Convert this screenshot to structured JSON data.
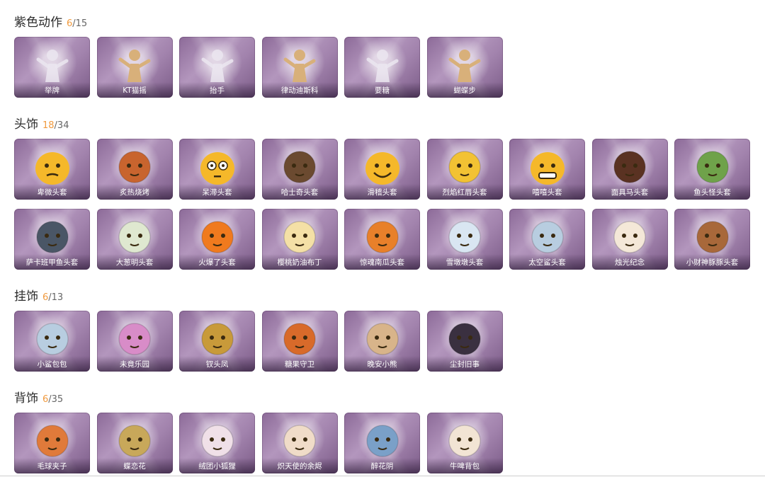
{
  "sections": [
    {
      "title": "紫色动作",
      "owned": "6",
      "total": "/15",
      "items": [
        {
          "label": "举牌",
          "icon": "sign-pose-icon"
        },
        {
          "label": "KT猫摇",
          "icon": "cat-shake-pose-icon"
        },
        {
          "label": "抬手",
          "icon": "raise-hand-pose-icon"
        },
        {
          "label": "律动迪斯科",
          "icon": "disco-pose-icon"
        },
        {
          "label": "要糖",
          "icon": "ask-candy-pose-icon"
        },
        {
          "label": "蝴蝶步",
          "icon": "butterfly-step-pose-icon"
        }
      ]
    },
    {
      "title": "头饰",
      "owned": "18",
      "total": "/34",
      "items": [
        {
          "label": "卑微头套",
          "icon": "humble-emoji-head-icon"
        },
        {
          "label": "炙热烧烤",
          "icon": "grill-head-icon"
        },
        {
          "label": "呆滞头套",
          "icon": "dazed-emoji-head-icon"
        },
        {
          "label": "哈士奇头套",
          "icon": "husky-head-icon"
        },
        {
          "label": "滑稽头套",
          "icon": "funny-emoji-head-icon"
        },
        {
          "label": "烈焰红唇头套",
          "icon": "pikachu-sunglasses-head-icon"
        },
        {
          "label": "嘻嘻头套",
          "icon": "grin-emoji-head-icon"
        },
        {
          "label": "面具马头套",
          "icon": "horse-mask-head-icon"
        },
        {
          "label": "鱼头怪头套",
          "icon": "fish-monster-head-icon"
        },
        {
          "label": "萨卡班甲鱼头套",
          "icon": "sacabambaspis-head-icon"
        },
        {
          "label": "大葱明头套",
          "icon": "scallion-head-icon"
        },
        {
          "label": "火爆了头套",
          "icon": "fire-head-icon"
        },
        {
          "label": "樱桃奶油布丁",
          "icon": "pudding-head-icon"
        },
        {
          "label": "惊魂南瓜头套",
          "icon": "pumpkin-head-icon"
        },
        {
          "label": "雪墩墩头套",
          "icon": "snow-deer-head-icon"
        },
        {
          "label": "太空鲨头套",
          "icon": "space-shark-head-icon"
        },
        {
          "label": "烛光纪念",
          "icon": "candle-head-icon"
        },
        {
          "label": "小财神豚豚头套",
          "icon": "capybara-god-head-icon"
        }
      ]
    },
    {
      "title": "挂饰",
      "owned": "6",
      "total": "/13",
      "items": [
        {
          "label": "小鲨包包",
          "icon": "shark-bag-pendant-icon"
        },
        {
          "label": "未竟乐园",
          "icon": "doll-pendant-icon"
        },
        {
          "label": "钗头凤",
          "icon": "phoenix-pendant-icon"
        },
        {
          "label": "糖果守卫",
          "icon": "candy-guard-pendant-icon"
        },
        {
          "label": "晚安小熊",
          "icon": "bear-pendant-icon"
        },
        {
          "label": "尘封旧事",
          "icon": "prince-pendant-icon"
        }
      ]
    },
    {
      "title": "背饰",
      "owned": "6",
      "total": "/35",
      "items": [
        {
          "label": "毛球夹子",
          "icon": "fox-clip-back-icon"
        },
        {
          "label": "蝶恋花",
          "icon": "butterfly-flower-back-icon"
        },
        {
          "label": "绒团小狐狸",
          "icon": "fluffy-fox-back-icon"
        },
        {
          "label": "炽天使的余烬",
          "icon": "angel-back-icon"
        },
        {
          "label": "醉花阴",
          "icon": "flower-cage-back-icon"
        },
        {
          "label": "牛啤背包",
          "icon": "cow-beer-back-icon"
        }
      ]
    }
  ]
}
